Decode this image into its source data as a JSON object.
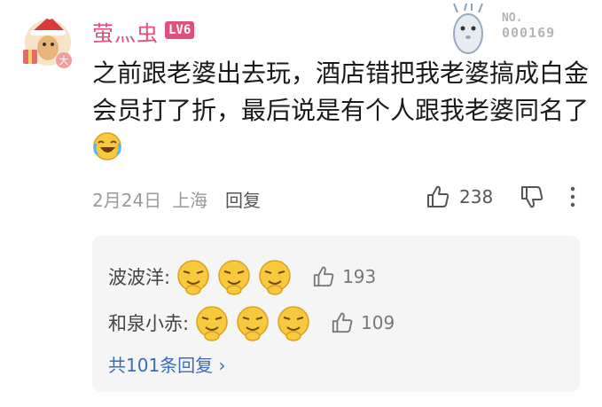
{
  "comment": {
    "username": "萤灬虫",
    "level": "LV6",
    "avatar_badge": "大",
    "text_before_emoji": "之前跟老婆出去玩，酒店错把我老婆搞成白金会员打了折，最后说是有个人跟我老婆同名了",
    "emoji": "laughing-crying-emoji",
    "no_label": "NO.",
    "no_number": "000169",
    "date": "2月24日",
    "location": "上海",
    "reply_label": "回复",
    "like_count": "238"
  },
  "replies": [
    {
      "name": "波波洋:",
      "emoji": "smirk-emoji",
      "emoji_count": 3,
      "like_count": "193"
    },
    {
      "name": "和泉小赤:",
      "emoji": "smirk-emoji",
      "emoji_count": 3,
      "like_count": "109"
    }
  ],
  "more_replies_label": "共101条回复 ›",
  "colors": {
    "username": "#e0507a",
    "link": "#3d6bb5",
    "meta": "#9a9a9a",
    "reply_bg": "#f5f5f5"
  }
}
